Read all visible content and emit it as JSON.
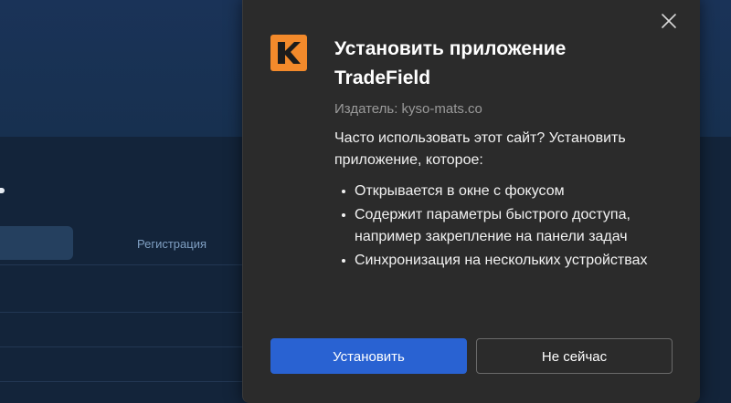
{
  "background": {
    "register_tab": "Регистрация"
  },
  "dialog": {
    "close_icon": "close-icon",
    "app_icon": "tradefield-logo-icon",
    "title": "Установить приложение TradeField",
    "publisher": "Издатель: kyso-mats.co",
    "question": "Часто использовать этот сайт? Установить приложение, которое:",
    "features": [
      "Открывается в окне с фокусом",
      "Содержит параметры быстрого доступа, например закрепление на панели задач",
      "Синхронизация на нескольких устройствах"
    ],
    "install_button": "Установить",
    "cancel_button": "Не сейчас"
  },
  "colors": {
    "dialog_bg": "#2b2b2b",
    "primary_button": "#2962d2",
    "app_icon_bg": "#f38a2b",
    "page_bg": "#13243a"
  }
}
